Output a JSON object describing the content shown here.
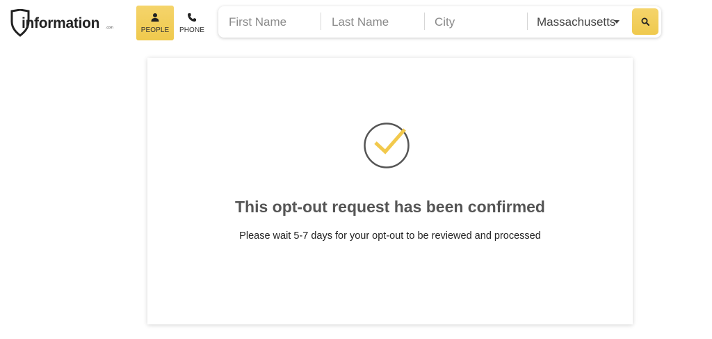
{
  "header": {
    "logo": {
      "text": "information",
      "tld": ".com"
    },
    "search_types": [
      {
        "label": "PEOPLE",
        "icon": "person-icon",
        "active": true
      },
      {
        "label": "PHONE",
        "icon": "phone-icon",
        "active": false
      }
    ],
    "search": {
      "first_name_placeholder": "First Name",
      "last_name_placeholder": "Last Name",
      "city_placeholder": "City",
      "state_selected": "Massachusetts",
      "button_icon": "search-icon"
    }
  },
  "confirmation": {
    "icon": "check-circle-icon",
    "title": "This opt-out request has been confirmed",
    "message": "Please wait 5-7 days for your opt-out to be reviewed and processed"
  },
  "colors": {
    "accent": "#f2cd57",
    "check_stroke": "#555555",
    "title_text": "#555555"
  }
}
